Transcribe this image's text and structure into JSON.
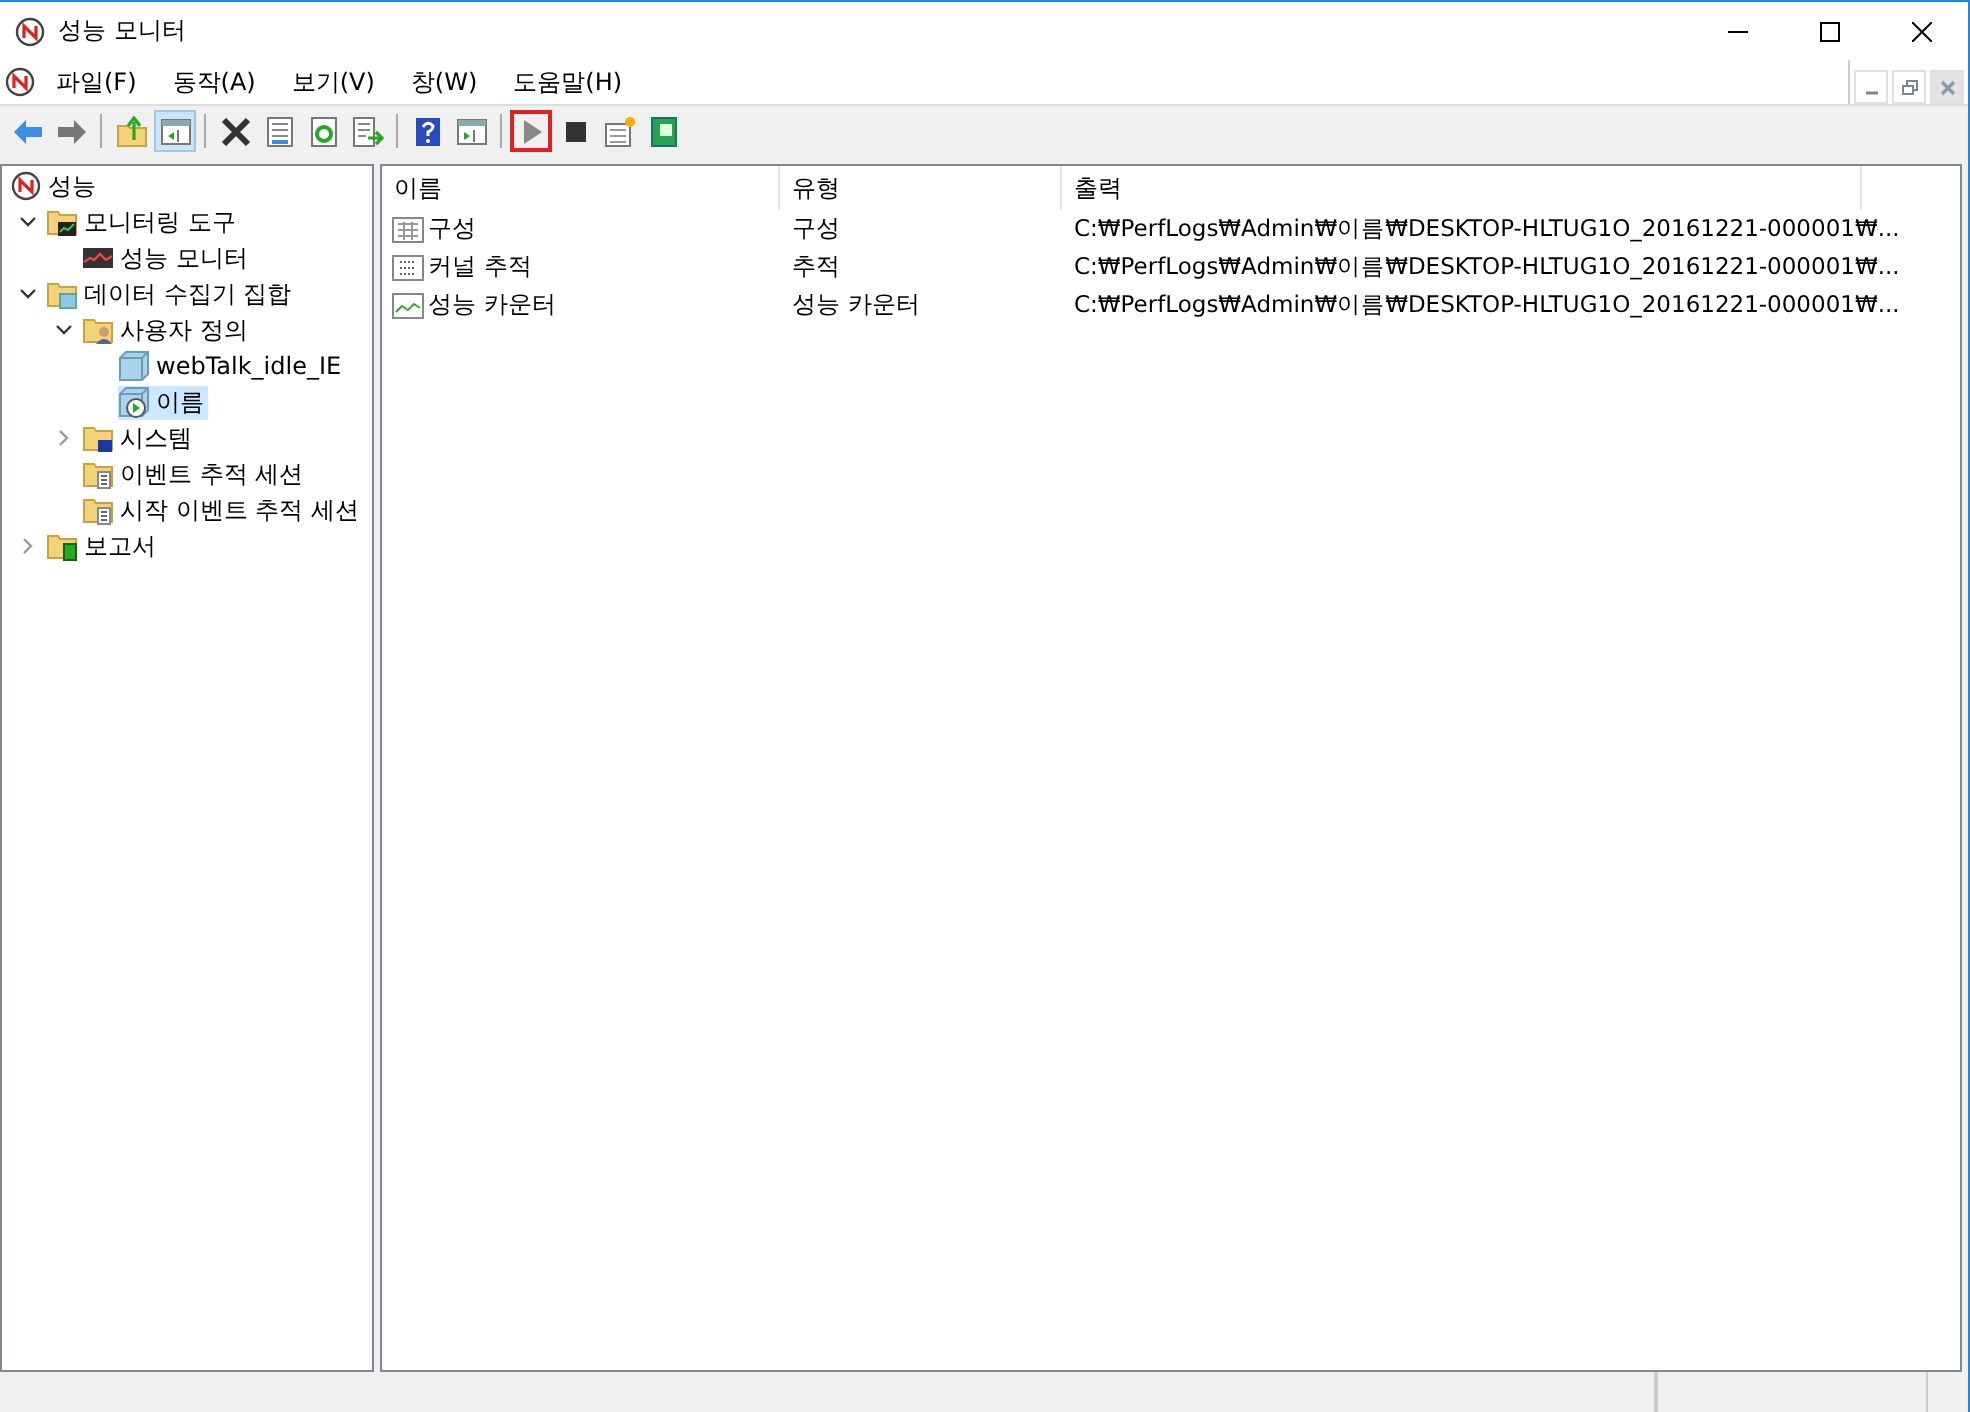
{
  "window": {
    "title": "성능 모니터"
  },
  "menu": [
    {
      "label": "파일(F)"
    },
    {
      "label": "동작(A)"
    },
    {
      "label": "보기(V)"
    },
    {
      "label": "창(W)"
    },
    {
      "label": "도움말(H)"
    }
  ],
  "toolbar": [
    {
      "kind": "back",
      "pressed": false,
      "focused": false
    },
    {
      "kind": "forward",
      "pressed": false,
      "focused": false
    },
    {
      "kind": "separator"
    },
    {
      "kind": "up",
      "pressed": false,
      "focused": false
    },
    {
      "kind": "pane",
      "pressed": true,
      "focused": false
    },
    {
      "kind": "separator"
    },
    {
      "kind": "delete",
      "pressed": false,
      "focused": false
    },
    {
      "kind": "properties",
      "pressed": false,
      "focused": false
    },
    {
      "kind": "refresh",
      "pressed": false,
      "focused": false
    },
    {
      "kind": "export",
      "pressed": false,
      "focused": false
    },
    {
      "kind": "separator"
    },
    {
      "kind": "help",
      "pressed": false,
      "focused": false
    },
    {
      "kind": "view",
      "pressed": false,
      "focused": false
    },
    {
      "kind": "separator"
    },
    {
      "kind": "start",
      "pressed": false,
      "focused": true
    },
    {
      "kind": "stop",
      "pressed": false,
      "focused": false
    },
    {
      "kind": "new",
      "pressed": false,
      "focused": false
    },
    {
      "kind": "book",
      "pressed": false,
      "focused": false
    }
  ],
  "tree": [
    {
      "label": "성능",
      "kind": "root",
      "selected": false,
      "children": [
        {
          "label": "모니터링 도구",
          "kind": "tools",
          "expanded": true,
          "selected": false,
          "children": [
            {
              "label": "성능 모니터",
              "kind": "monitor",
              "selected": false
            }
          ]
        },
        {
          "label": "데이터 수집기 집합",
          "kind": "collector",
          "expanded": true,
          "selected": false,
          "children": [
            {
              "label": "사용자 정의",
              "kind": "user",
              "expanded": true,
              "selected": false,
              "children": [
                {
                  "label": "webTalk_idle_IE",
                  "kind": "set",
                  "selected": false
                },
                {
                  "label": "이름",
                  "kind": "running",
                  "selected": true
                }
              ]
            },
            {
              "label": "시스템",
              "kind": "system",
              "expanded": false,
              "selected": false
            },
            {
              "label": "이벤트 추적 세션",
              "kind": "trace",
              "selected": false
            },
            {
              "label": "시작 이벤트 추적 세션",
              "kind": "trace",
              "selected": false
            }
          ]
        },
        {
          "label": "보고서",
          "kind": "report",
          "expanded": false,
          "selected": false
        }
      ]
    }
  ],
  "table": {
    "columns": [
      "이름",
      "유형",
      "출력"
    ],
    "rows": [
      {
        "kind": "config",
        "name": "구성",
        "type": "구성",
        "output": "C:₩PerfLogs₩Admin₩이름₩DESKTOP-HLTUG1O_20161221-000001₩..."
      },
      {
        "kind": "kernel",
        "name": "커널 추적",
        "type": "추적",
        "output": "C:₩PerfLogs₩Admin₩이름₩DESKTOP-HLTUG1O_20161221-000001₩..."
      },
      {
        "kind": "counter",
        "name": "성능 카운터",
        "type": "성능 카운터",
        "output": "C:₩PerfLogs₩Admin₩이름₩DESKTOP-HLTUG1O_20161221-000001₩..."
      }
    ]
  }
}
